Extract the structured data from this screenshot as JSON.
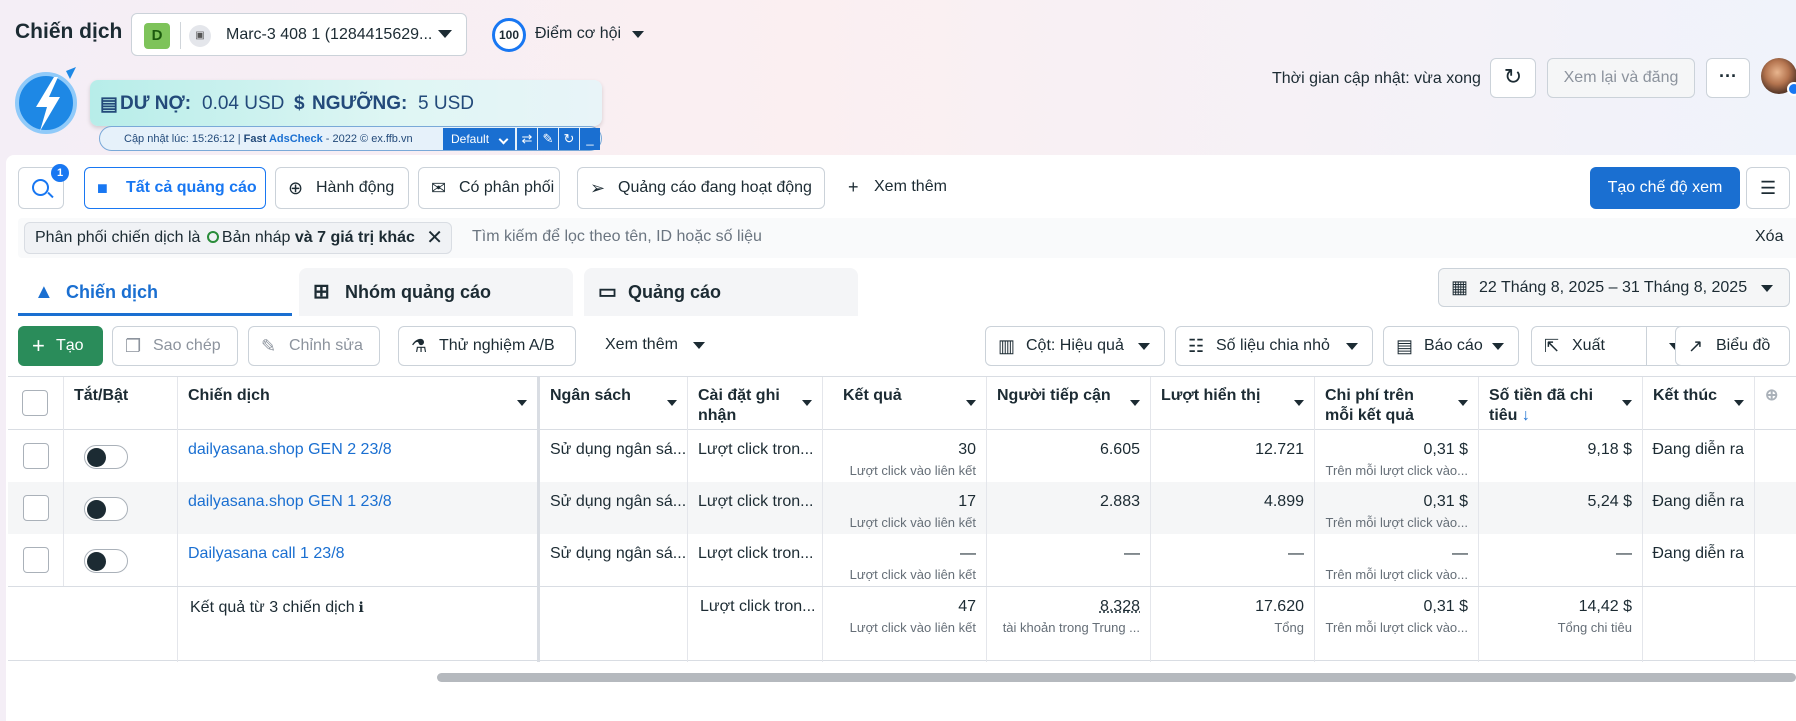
{
  "header": {
    "title": "Chiến dịch",
    "account_letter": "D",
    "account_name": "Marc-3 408 1 (1284415629...",
    "opportunity_score": "100",
    "opportunity_label": "Điểm cơ hội",
    "update_time": "Thời gian cập nhật: vừa xong",
    "review_publish": "Xem lại và đăng",
    "more_label": "···"
  },
  "adscheck": {
    "debt_label": "DƯ NỢ:",
    "debt_value": "0.04 USD",
    "threshold_label": "NGƯỠNG:",
    "threshold_value": "5 USD",
    "update_line_pre": "Cập nhật lúc: 15:26:12 | ",
    "brand_fast": "Fast ",
    "brand_adscheck": "AdsCheck",
    "update_line_post": " - 2022 © ex.ffb.vn",
    "preset": "Default"
  },
  "toolbar": {
    "search_badge": "1",
    "all_ads": "Tất cả quảng cáo",
    "actions": "Hành động",
    "with_delivery": "Có phân phối",
    "active_ads": "Quảng cáo đang hoạt động",
    "see_more": "Xem thêm",
    "create_view": "Tạo chế độ xem"
  },
  "filter": {
    "chip_pre": "Phân phối chiến dịch là ",
    "chip_value": "Bản nháp",
    "chip_post": " và 7 giá trị khác",
    "search_placeholder": "Tìm kiếm để lọc theo tên, ID hoặc số liệu",
    "clear": "Xóa"
  },
  "tabs": [
    {
      "label": "Chiến dịch"
    },
    {
      "label": "Nhóm quảng cáo"
    },
    {
      "label": "Quảng cáo"
    }
  ],
  "date_range": "22 Tháng 8, 2025 – 31 Tháng 8, 2025",
  "actions": {
    "create": "Tạo",
    "copy": "Sao chép",
    "edit": "Chỉnh sửa",
    "ab_test": "Thử nghiệm A/B",
    "more": "Xem thêm",
    "columns": "Cột: Hiệu quả",
    "breakdown": "Số liệu chia nhỏ",
    "report": "Báo cáo",
    "export": "Xuất",
    "chart": "Biểu đồ"
  },
  "table": {
    "headers": {
      "onoff": "Tắt/Bật",
      "campaign": "Chiến dịch",
      "budget": "Ngân sách",
      "attribution": "Cài đặt ghi nhận",
      "results": "Kết quả",
      "reach": "Người tiếp cận",
      "impressions": "Lượt hiển thị",
      "cpr": "Chi phí trên mỗi kết quả",
      "spent": "Số tiền đã chi tiêu",
      "spent_arrow": "↓",
      "ends": "Kết thúc"
    },
    "rows": [
      {
        "name": "dailyasana.shop GEN 2 23/8",
        "budget": "Sử dụng ngân sá...",
        "attribution": "Lượt click tron...",
        "results": "30",
        "results_sub": "Lượt click vào liên kết",
        "reach": "6.605",
        "impressions": "12.721",
        "cpr": "0,31 $",
        "cpr_sub": "Trên mỗi lượt click vào...",
        "spent": "9,18 $",
        "ends": "Đang diễn ra"
      },
      {
        "name": "dailyasana.shop GEN 1 23/8",
        "budget": "Sử dụng ngân sá...",
        "attribution": "Lượt click tron...",
        "results": "17",
        "results_sub": "Lượt click vào liên kết",
        "reach": "2.883",
        "impressions": "4.899",
        "cpr": "0,31 $",
        "cpr_sub": "Trên mỗi lượt click vào...",
        "spent": "5,24 $",
        "ends": "Đang diễn ra"
      },
      {
        "name": "Dailyasana call 1 23/8",
        "budget": "Sử dụng ngân sá...",
        "attribution": "Lượt click tron...",
        "results": "—",
        "results_sub": "Lượt click vào liên kết",
        "reach": "—",
        "impressions": "—",
        "cpr": "—",
        "cpr_sub": "Trên mỗi lượt click vào...",
        "spent": "—",
        "ends": "Đang diễn ra"
      }
    ],
    "summary": {
      "label": "Kết quả từ 3 chiến dịch",
      "attribution": "Lượt click tron...",
      "results": "47",
      "results_sub": "Lượt click vào liên kết",
      "reach": "8.328",
      "reach_sub": "tài khoản trong Trung ...",
      "impressions": "17.620",
      "impressions_sub": "Tổng",
      "cpr": "0,31 $",
      "cpr_sub": "Trên mỗi lượt click vào...",
      "spent": "14,42 $",
      "spent_sub": "Tổng chi tiêu"
    }
  },
  "colors": {
    "primary": "#1a6fd1",
    "create_green": "#2a8c5a",
    "draft_dot": "#2a8c3a"
  }
}
